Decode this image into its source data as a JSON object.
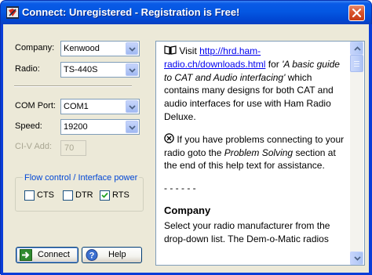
{
  "window": {
    "title": "Connect: Unregistered - Registration is Free!"
  },
  "form": {
    "company_label": "Company:",
    "company_value": "Kenwood",
    "radio_label": "Radio:",
    "radio_value": "TS-440S",
    "com_port_label": "COM Port:",
    "com_port_value": "COM1",
    "speed_label": "Speed:",
    "speed_value": "19200",
    "civ_label": "CI-V Add:",
    "civ_value": "70"
  },
  "flow_control": {
    "title": "Flow control / Interface power",
    "cts_label": "CTS",
    "cts_checked": false,
    "dtr_label": "DTR",
    "dtr_checked": false,
    "rts_label": "RTS",
    "rts_checked": true
  },
  "buttons": {
    "connect_label": "Connect",
    "help_label": "Help"
  },
  "help": {
    "p1_pre": " Visit ",
    "p1_link": "http://hrd.ham-radio.ch/downloads.html",
    "p1_mid": " for ",
    "p1_italic": "'A basic guide to CAT and Audio interfacing'",
    "p1_post": " which contains many designs for both CAT and audio interfaces for use with Ham Radio Deluxe.",
    "p2_pre": " If you have problems connecting to your radio goto the ",
    "p2_italic": "Problem Solving",
    "p2_post": " section at the end of this help text for assistance.",
    "divider": "- - - - - -",
    "heading": "Company",
    "p3": "Select your radio manufacturer from the drop-down list. The Dem-o-Matic radios"
  },
  "colors": {
    "title_bar": "#0457e2",
    "dialog_bg": "#ece9d8",
    "link": "#0000ee",
    "group_title": "#0046d5"
  },
  "icons": {
    "app": "hrd-logo-icon",
    "close": "close-icon",
    "book": "book-icon",
    "problem": "no-entry-icon",
    "connect": "arrow-right-icon",
    "help": "question-icon"
  }
}
